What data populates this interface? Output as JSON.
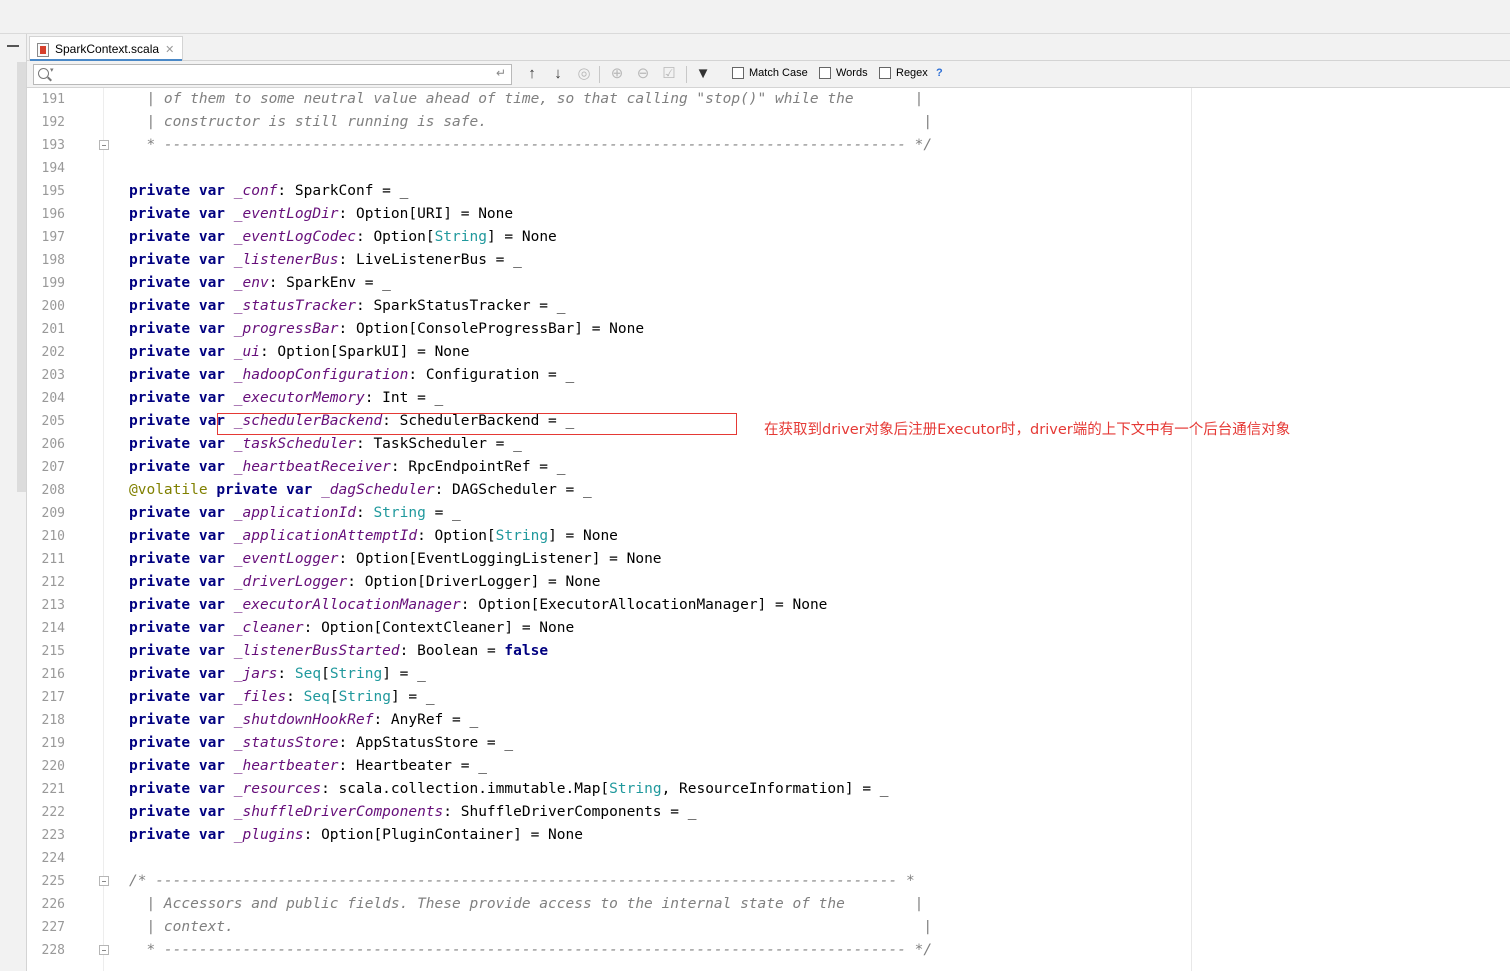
{
  "tab": {
    "label": "SparkContext.scala",
    "close_glyph": "✕"
  },
  "search": {
    "value": "",
    "placeholder": "",
    "match_case_label": "Match Case",
    "words_label": "Words",
    "regex_label": "Regex",
    "help_label": "?"
  },
  "annotation": {
    "text": "在获取到driver对象后注册Executor时，driver端的上下文中有一个后台通信对象"
  },
  "colors": {
    "keyword": "#000080",
    "field": "#660e7a",
    "type_builtin": "#20999d",
    "annotation": "#808000",
    "comment": "#808080",
    "highlight": "#e53935",
    "tab_accent": "#4a88c7"
  },
  "lines": [
    {
      "n": "191",
      "tokens": [
        {
          "t": "  | of them to some neutral value ahead of time, so that calling \"stop()\" while the       |",
          "c": "cm"
        }
      ]
    },
    {
      "n": "192",
      "tokens": [
        {
          "t": "  | constructor is still running is safe.                                                  |",
          "c": "cm"
        }
      ]
    },
    {
      "n": "193",
      "fold": true,
      "tokens": [
        {
          "t": "  * ------------------------------------------------------------------------------------- */",
          "c": "cm"
        }
      ]
    },
    {
      "n": "194",
      "tokens": []
    },
    {
      "n": "195",
      "tokens": [
        {
          "t": "private var ",
          "c": "kw"
        },
        {
          "t": "_conf",
          "c": "fld"
        },
        {
          "t": ": SparkConf = _",
          "c": ""
        }
      ]
    },
    {
      "n": "196",
      "tokens": [
        {
          "t": "private var ",
          "c": "kw"
        },
        {
          "t": "_eventLogDir",
          "c": "fld"
        },
        {
          "t": ": Option[URI] = None",
          "c": ""
        }
      ]
    },
    {
      "n": "197",
      "tokens": [
        {
          "t": "private var ",
          "c": "kw"
        },
        {
          "t": "_eventLogCodec",
          "c": "fld"
        },
        {
          "t": ": Option[",
          "c": ""
        },
        {
          "t": "String",
          "c": "tp"
        },
        {
          "t": "] = None",
          "c": ""
        }
      ]
    },
    {
      "n": "198",
      "tokens": [
        {
          "t": "private var ",
          "c": "kw"
        },
        {
          "t": "_listenerBus",
          "c": "fld"
        },
        {
          "t": ": LiveListenerBus = _",
          "c": ""
        }
      ]
    },
    {
      "n": "199",
      "tokens": [
        {
          "t": "private var ",
          "c": "kw"
        },
        {
          "t": "_env",
          "c": "fld"
        },
        {
          "t": ": SparkEnv = _",
          "c": ""
        }
      ]
    },
    {
      "n": "200",
      "tokens": [
        {
          "t": "private var ",
          "c": "kw"
        },
        {
          "t": "_statusTracker",
          "c": "fld"
        },
        {
          "t": ": SparkStatusTracker = _",
          "c": ""
        }
      ]
    },
    {
      "n": "201",
      "tokens": [
        {
          "t": "private var ",
          "c": "kw"
        },
        {
          "t": "_progressBar",
          "c": "fld"
        },
        {
          "t": ": Option[ConsoleProgressBar] = None",
          "c": ""
        }
      ]
    },
    {
      "n": "202",
      "tokens": [
        {
          "t": "private var ",
          "c": "kw"
        },
        {
          "t": "_ui",
          "c": "fld"
        },
        {
          "t": ": Option[SparkUI] = None",
          "c": ""
        }
      ]
    },
    {
      "n": "203",
      "tokens": [
        {
          "t": "private var ",
          "c": "kw"
        },
        {
          "t": "_hadoopConfiguration",
          "c": "fld"
        },
        {
          "t": ": Configuration = _",
          "c": ""
        }
      ]
    },
    {
      "n": "204",
      "tokens": [
        {
          "t": "private var ",
          "c": "kw"
        },
        {
          "t": "_executorMemory",
          "c": "fld"
        },
        {
          "t": ": Int = _",
          "c": ""
        }
      ]
    },
    {
      "n": "205",
      "tokens": [
        {
          "t": "private var ",
          "c": "kw"
        },
        {
          "t": "_schedulerBackend",
          "c": "fld"
        },
        {
          "t": ": SchedulerBackend = _",
          "c": ""
        }
      ]
    },
    {
      "n": "206",
      "tokens": [
        {
          "t": "private var ",
          "c": "kw"
        },
        {
          "t": "_taskScheduler",
          "c": "fld"
        },
        {
          "t": ": TaskScheduler = _",
          "c": ""
        }
      ]
    },
    {
      "n": "207",
      "tokens": [
        {
          "t": "private var ",
          "c": "kw"
        },
        {
          "t": "_heartbeatReceiver",
          "c": "fld"
        },
        {
          "t": ": RpcEndpointRef = _",
          "c": ""
        }
      ]
    },
    {
      "n": "208",
      "tokens": [
        {
          "t": "@volatile ",
          "c": "ann"
        },
        {
          "t": "private var ",
          "c": "kw"
        },
        {
          "t": "_dagScheduler",
          "c": "fld"
        },
        {
          "t": ": DAGScheduler = _",
          "c": ""
        }
      ]
    },
    {
      "n": "209",
      "tokens": [
        {
          "t": "private var ",
          "c": "kw"
        },
        {
          "t": "_applicationId",
          "c": "fld"
        },
        {
          "t": ": ",
          "c": ""
        },
        {
          "t": "String",
          "c": "tp"
        },
        {
          "t": " = _",
          "c": ""
        }
      ]
    },
    {
      "n": "210",
      "tokens": [
        {
          "t": "private var ",
          "c": "kw"
        },
        {
          "t": "_applicationAttemptId",
          "c": "fld"
        },
        {
          "t": ": Option[",
          "c": ""
        },
        {
          "t": "String",
          "c": "tp"
        },
        {
          "t": "] = None",
          "c": ""
        }
      ]
    },
    {
      "n": "211",
      "tokens": [
        {
          "t": "private var ",
          "c": "kw"
        },
        {
          "t": "_eventLogger",
          "c": "fld"
        },
        {
          "t": ": Option[EventLoggingListener] = None",
          "c": ""
        }
      ]
    },
    {
      "n": "212",
      "tokens": [
        {
          "t": "private var ",
          "c": "kw"
        },
        {
          "t": "_driverLogger",
          "c": "fld"
        },
        {
          "t": ": Option[DriverLogger] = None",
          "c": ""
        }
      ]
    },
    {
      "n": "213",
      "tokens": [
        {
          "t": "private var ",
          "c": "kw"
        },
        {
          "t": "_executorAllocationManager",
          "c": "fld"
        },
        {
          "t": ": Option[ExecutorAllocationManager] = None",
          "c": ""
        }
      ]
    },
    {
      "n": "214",
      "tokens": [
        {
          "t": "private var ",
          "c": "kw"
        },
        {
          "t": "_cleaner",
          "c": "fld"
        },
        {
          "t": ": Option[ContextCleaner] = None",
          "c": ""
        }
      ]
    },
    {
      "n": "215",
      "tokens": [
        {
          "t": "private var ",
          "c": "kw"
        },
        {
          "t": "_listenerBusStarted",
          "c": "fld"
        },
        {
          "t": ": Boolean = ",
          "c": ""
        },
        {
          "t": "false",
          "c": "kw"
        }
      ]
    },
    {
      "n": "216",
      "tokens": [
        {
          "t": "private var ",
          "c": "kw"
        },
        {
          "t": "_jars",
          "c": "fld"
        },
        {
          "t": ": ",
          "c": ""
        },
        {
          "t": "Seq",
          "c": "tp"
        },
        {
          "t": "[",
          "c": ""
        },
        {
          "t": "String",
          "c": "tp"
        },
        {
          "t": "] = _",
          "c": ""
        }
      ]
    },
    {
      "n": "217",
      "tokens": [
        {
          "t": "private var ",
          "c": "kw"
        },
        {
          "t": "_files",
          "c": "fld"
        },
        {
          "t": ": ",
          "c": ""
        },
        {
          "t": "Seq",
          "c": "tp"
        },
        {
          "t": "[",
          "c": ""
        },
        {
          "t": "String",
          "c": "tp"
        },
        {
          "t": "] = _",
          "c": ""
        }
      ]
    },
    {
      "n": "218",
      "tokens": [
        {
          "t": "private var ",
          "c": "kw"
        },
        {
          "t": "_shutdownHookRef",
          "c": "fld"
        },
        {
          "t": ": AnyRef = _",
          "c": ""
        }
      ]
    },
    {
      "n": "219",
      "tokens": [
        {
          "t": "private var ",
          "c": "kw"
        },
        {
          "t": "_statusStore",
          "c": "fld"
        },
        {
          "t": ": AppStatusStore = _",
          "c": ""
        }
      ]
    },
    {
      "n": "220",
      "tokens": [
        {
          "t": "private var ",
          "c": "kw"
        },
        {
          "t": "_heartbeater",
          "c": "fld"
        },
        {
          "t": ": Heartbeater = _",
          "c": ""
        }
      ]
    },
    {
      "n": "221",
      "tokens": [
        {
          "t": "private var ",
          "c": "kw"
        },
        {
          "t": "_resources",
          "c": "fld"
        },
        {
          "t": ": scala.collection.immutable.Map[",
          "c": ""
        },
        {
          "t": "String",
          "c": "tp"
        },
        {
          "t": ", ResourceInformation] = _",
          "c": ""
        }
      ]
    },
    {
      "n": "222",
      "tokens": [
        {
          "t": "private var ",
          "c": "kw"
        },
        {
          "t": "_shuffleDriverComponents",
          "c": "fld"
        },
        {
          "t": ": ShuffleDriverComponents = _",
          "c": ""
        }
      ]
    },
    {
      "n": "223",
      "tokens": [
        {
          "t": "private var ",
          "c": "kw"
        },
        {
          "t": "_plugins",
          "c": "fld"
        },
        {
          "t": ": Option[PluginContainer] = None",
          "c": ""
        }
      ]
    },
    {
      "n": "224",
      "tokens": []
    },
    {
      "n": "225",
      "fold": true,
      "tokens": [
        {
          "t": "/* ------------------------------------------------------------------------------------- *",
          "c": "cm"
        }
      ]
    },
    {
      "n": "226",
      "tokens": [
        {
          "t": "  | Accessors and public fields. These provide access to the internal state of the        |",
          "c": "cm"
        }
      ]
    },
    {
      "n": "227",
      "tokens": [
        {
          "t": "  | context.                                                                               |",
          "c": "cm"
        }
      ]
    },
    {
      "n": "228",
      "fold": true,
      "tokens": [
        {
          "t": "  * ------------------------------------------------------------------------------------- */",
          "c": "cm"
        }
      ]
    }
  ]
}
